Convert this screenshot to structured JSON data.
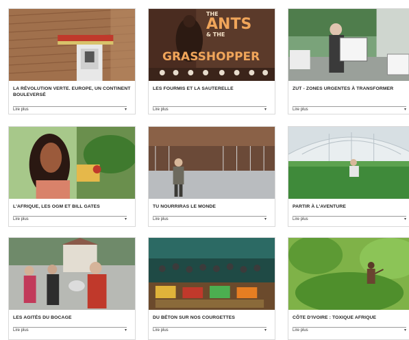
{
  "cards": [
    {
      "title": "LA RÉVOLUTION VERTE. EUROPE, UN CONTINENT BOULEVERSÉ",
      "more": "Lire plus",
      "chevron": "▾",
      "thumb": "tractor-field-image"
    },
    {
      "title": "LES FOURMIS ET LA SAUTERELLE",
      "more": "Lire plus",
      "chevron": "▾",
      "thumb": "ants-grasshopper-poster",
      "poster": {
        "line1": "THE",
        "line2": "ANTS",
        "line3": "& THE",
        "line4": "GRASSHOPPER"
      }
    },
    {
      "title": "ZUT - ZONES URGENTES À TRANSFORMER",
      "more": "Lire plus",
      "chevron": "▾",
      "thumb": "protester-sign-image"
    },
    {
      "title": "L'AFRIQUE, LES OGM ET BILL GATES",
      "more": "Lire plus",
      "chevron": "▾",
      "thumb": "woman-plants-image"
    },
    {
      "title": "TU NOURRIRAS LE MONDE",
      "more": "Lire plus",
      "chevron": "▾",
      "thumb": "farmer-barn-image"
    },
    {
      "title": "PARTIR À L'AVENTURE",
      "more": "Lire plus",
      "chevron": "▾",
      "thumb": "greenhouse-image"
    },
    {
      "title": "LES AGITÉS DU BOCAGE",
      "more": "Lire plus",
      "chevron": "▾",
      "thumb": "village-crowd-image"
    },
    {
      "title": "DU BÉTON SUR NOS COURGETTES",
      "more": "Lire plus",
      "chevron": "▾",
      "thumb": "market-crowd-image"
    },
    {
      "title": "CÔTE D'IVOIRE : TOXIQUE AFRIQUE",
      "more": "Lire plus",
      "chevron": "▾",
      "thumb": "jungle-farmer-image"
    }
  ]
}
